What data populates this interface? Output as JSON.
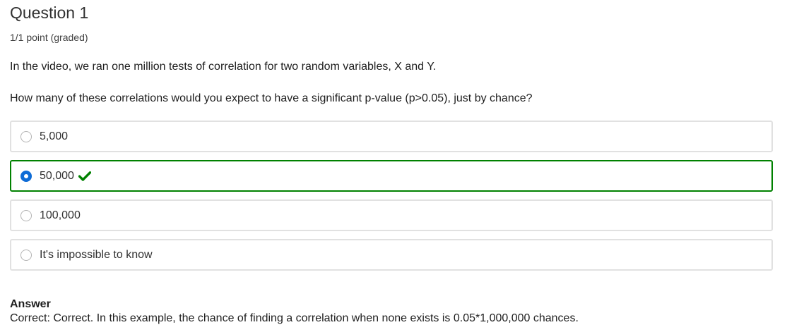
{
  "question": {
    "title": "Question 1",
    "points": "1/1 point (graded)",
    "prompt_1": "In the video, we ran one million tests of correlation for two random variables, X and Y.",
    "prompt_2": "How many of these correlations would you expect to have a significant p-value (p>0.05), just by chance?"
  },
  "options": [
    {
      "label": "5,000",
      "selected": false,
      "correct": false
    },
    {
      "label": "50,000",
      "selected": true,
      "correct": true
    },
    {
      "label": "100,000",
      "selected": false,
      "correct": false
    },
    {
      "label": "It's impossible to know",
      "selected": false,
      "correct": false
    }
  ],
  "answer": {
    "heading": "Answer",
    "text": "Correct:  Correct. In this example, the chance of finding a correlation when none exists is 0.05*1,000,000 chances."
  },
  "colors": {
    "correct_border": "#008100",
    "selected_radio": "#0f6cd6",
    "checkmark": "#008100"
  },
  "icons": {
    "checkmark": "check-icon"
  }
}
